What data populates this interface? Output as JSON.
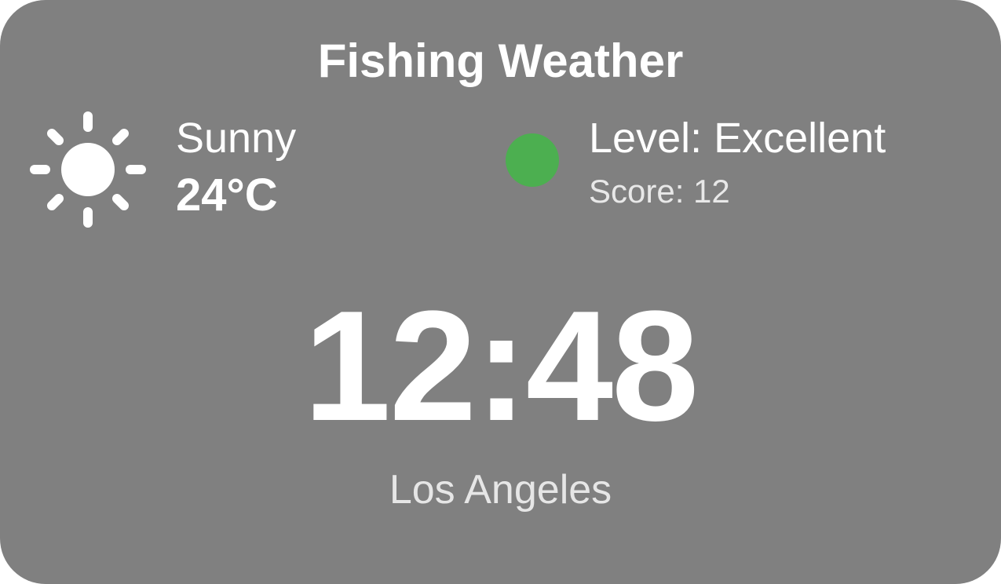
{
  "widget": {
    "title": "Fishing Weather",
    "weather": {
      "icon": "sun-icon",
      "condition": "Sunny",
      "temperature": "24°C"
    },
    "fishing": {
      "level": "Level: Excellent",
      "score": "Score: 12",
      "status_color": "#4caf50"
    },
    "clock": {
      "time": "12:48",
      "location": "Los Angeles"
    }
  },
  "colors": {
    "card_background": "#808080",
    "text": "#ffffff"
  }
}
